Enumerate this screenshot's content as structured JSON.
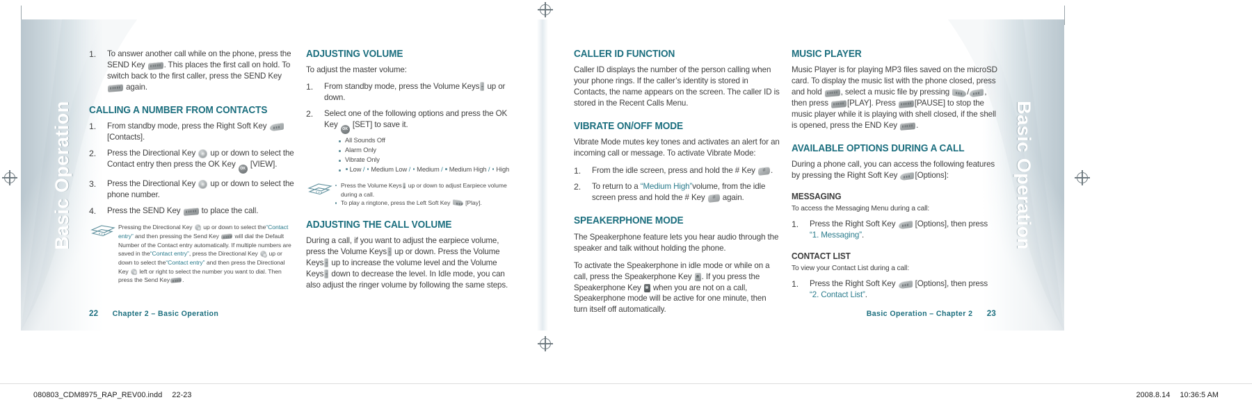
{
  "document": {
    "edge_title": "Basic Operation",
    "accent_teal": "#1b6e7e",
    "body_gray": "#3d3d3d"
  },
  "left_page": {
    "page_number": "22",
    "footer_text": "Chapter 2 – Basic Operation"
  },
  "right_page": {
    "page_number": "23",
    "footer_text": "Basic Operation – Chapter 2"
  },
  "col1": {
    "carry_step": {
      "num": "1.",
      "t1": "To answer another call while on the phone, press the SEND Key",
      "t2": ". This places the first call on hold. To switch back to the first caller, press the SEND Key",
      "t3": "again."
    },
    "heading": "CALLING A NUMBER FROM CONTACTS",
    "steps": [
      {
        "t1": "From standby mode, press the Right Soft Key",
        "t2": "[Contacts]."
      },
      {
        "t1": "Press the Directional Key",
        "t2": "up or down to select the Contact entry then press the OK Key",
        "t3": "[VIEW]."
      },
      {
        "t1": "Press the Directional Key",
        "t2": "up or down to select the phone number."
      },
      {
        "t1": "Press the SEND Key",
        "t2": "to place the call."
      }
    ],
    "note": {
      "t1": "Pressing the Directional Key",
      "t2": "up or down to select the",
      "q1": "“Contact entry”",
      "t3": "and then pressing the Send Key",
      "t4": "will dial the Default Number of the Contact entry automatically. If multiple numbers are saved in the",
      "q2": "“Contact entry”",
      "t5": ", press the Directional Key",
      "t6": "up or down to select the",
      "q3": "“Contact entry”",
      "t7": "and then press the Directional Key",
      "t8": "left or right to select the number you want to dial. Then press the Send Key",
      "t9": "."
    }
  },
  "col2": {
    "heading1": "ADJUSTING VOLUME",
    "lead1": "To adjust the master volume:",
    "steps": [
      {
        "t1": "From standby mode, press the Volume Keys",
        "t2": "up or down."
      },
      {
        "t1": "Select one of the following options and press the OK Key",
        "t2": "[SET] to save it."
      }
    ],
    "options": [
      "All Sounds Off",
      "Alarm Only",
      "Vibrate Only"
    ],
    "levels": [
      "Low",
      "Medium Low",
      "Medium",
      "Medium High",
      "High"
    ],
    "note": {
      "l1a": "Press the Volume Keys",
      "l1b": "up or down to adjust Earpiece volume during a call.",
      "l2a": "To play a ringtone, press the Left Soft Key",
      "l2b": "[Play]."
    },
    "heading2": "ADJUSTING THE CALL VOLUME",
    "body2a": "During a call, if you want to adjust the earpiece volume, press the Volume Keys",
    "body2b": "up or down. Press the Volume Keys",
    "body2c": "up to increase the volume level and the Volume Keys",
    "body2d": "down to decrease the level. In Idle mode, you can also adjust the ringer volume by following the same steps."
  },
  "col3": {
    "heading1": "CALLER ID FUNCTION",
    "body1": "Caller ID displays the number of the person calling when your phone rings. If the caller’s identity is stored in Contacts, the name appears on the screen. The caller ID is stored in the Recent Calls Menu.",
    "heading2": "VIBRATE ON/OFF MODE",
    "body2": "Vibrate Mode mutes key tones and activates an alert for an incoming call or message. To activate Vibrate Mode:",
    "steps": [
      {
        "t1": "From the idle screen, press and hold the # Key",
        "t2": "."
      },
      {
        "t1": "To return to a",
        "q": "“Medium High”",
        "t2": "volume, from the idle screen press and hold the # Key",
        "t3": "again."
      }
    ],
    "heading3": "SPEAKERPHONE MODE",
    "body3": "The Speakerphone feature lets you hear audio through the speaker and talk without holding the phone.",
    "body4a": "To activate the Speakerphone in idle mode or while on a call, press the Speakerphone Key",
    "body4b": ". If you press the Speakerphone Key",
    "body4c": "when you are not on a call, Speakerphone mode will be active for one minute, then turn itself off automatically."
  },
  "col4": {
    "heading1": "MUSIC PLAYER",
    "body1a": "Music Player is for playing MP3 files saved on the microSD card. To display the music list with the phone closed, press and hold",
    "body1b": ", select a music file by pressing",
    "body1c": "/",
    "body1d": ", then press",
    "body1e": "[PLAY]. Press",
    "body1f": "[PAUSE] to stop the music player while it is playing with shell closed, if the shell is opened, press the END Key",
    "body1g": ".",
    "heading2": "AVAILABLE OPTIONS DURING A CALL",
    "body2a": "During a phone call, you can access the following features by pressing the Right Soft Key",
    "body2b": "[Options]:",
    "sub1": "MESSAGING",
    "sub1_lead": "To access the Messaging Menu during a call:",
    "sub1_step": {
      "t1": "Press the Right Soft Key",
      "t2": "[Options], then press",
      "q": "“1. Messaging”",
      "t3": "."
    },
    "sub2": "CONTACT LIST",
    "sub2_lead": "To view your Contact List during a call:",
    "sub2_step": {
      "t1": "Press the Right Soft Key",
      "t2": "[Options], then press",
      "q": "“2. Contact List”",
      "t3": "."
    }
  },
  "slug": {
    "left_file": "080803_CDM8975_RAP_REV00.indd",
    "left_pages": "22-23",
    "right_date": "2008.8.14",
    "right_time": "10:36:5 AM"
  }
}
